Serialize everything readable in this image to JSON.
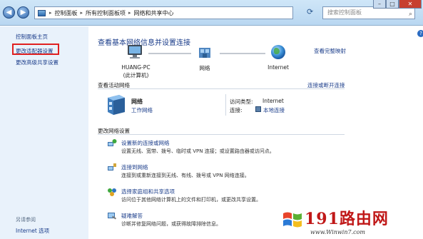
{
  "address_bar": {
    "crumbs": [
      "控制面板",
      "所有控制面板项",
      "网络和共享中心"
    ],
    "search_placeholder": "搜索控制面板"
  },
  "sidebar": {
    "home": "控制面板主页",
    "items": [
      "更改适配器设置",
      "更改高级共享设置"
    ],
    "see_also": "另请参阅",
    "internet_options": "Internet 选项"
  },
  "main": {
    "heading": "查看基本网络信息并设置连接",
    "view_full_map": "查看完整映射",
    "nodes": {
      "pc_name": "HUANG-PC",
      "pc_sub": "(此计算机)",
      "network": "网络",
      "internet": "Internet"
    },
    "active_title": "查看活动网络",
    "connect_disconnect": "连接或断开连接",
    "network_name": "网络",
    "network_type": "工作网络",
    "access_type_label": "访问类型:",
    "access_type_value": "Internet",
    "connection_label": "连接:",
    "connection_value": "本地连接",
    "change_title": "更改网络设置",
    "tasks": [
      {
        "title": "设置新的连接或网络",
        "desc": "设置无线、宽带、拨号、临时或 VPN 连接；或设置路由器或访问点。"
      },
      {
        "title": "连接到网络",
        "desc": "连接到或重新连接到无线、有线、拨号或 VPN 网络连接。"
      },
      {
        "title": "选择家庭组和共享选项",
        "desc": "访问位于其他网络计算机上的文件和打印机，或更改共享设置。"
      },
      {
        "title": "疑难解答",
        "desc": "诊断并修复网络问题，或获得故障排除信息。"
      }
    ]
  },
  "watermark": {
    "text": "191路由网",
    "url": "www.Winwin7.com"
  },
  "colors": {
    "link": "#1a3c8a",
    "sidebar_bg": "#e9f2fb",
    "highlight_box": "#e02020",
    "watermark": "#c01818"
  }
}
